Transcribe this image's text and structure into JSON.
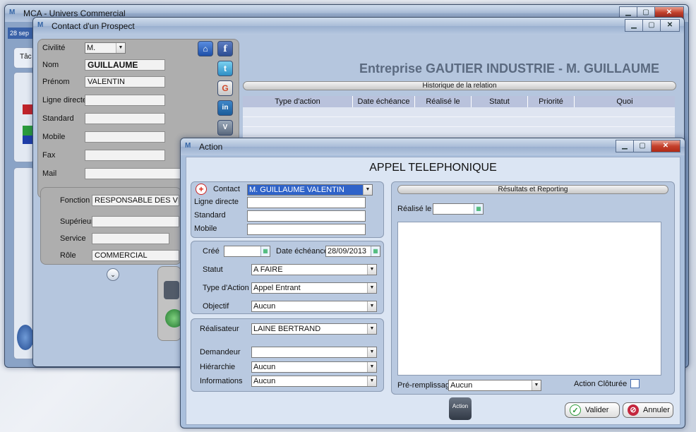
{
  "main_window": {
    "title": "MCA - Univers Commercial",
    "date_partial": "28 sep",
    "tab_partial": "Tâc"
  },
  "contact_window": {
    "title": "Contact d'un Prospect",
    "fields": {
      "civilite": {
        "label": "Civilité",
        "value": "M."
      },
      "nom": {
        "label": "Nom",
        "value": "GUILLAUME"
      },
      "prenom": {
        "label": "Prénom",
        "value": "VALENTIN"
      },
      "ligne_directe": {
        "label": "Ligne directe",
        "value": ""
      },
      "standard": {
        "label": "Standard",
        "value": ""
      },
      "mobile": {
        "label": "Mobile",
        "value": ""
      },
      "fax": {
        "label": "Fax",
        "value": ""
      },
      "mail": {
        "label": "Mail",
        "value": ""
      },
      "fonction": {
        "label": "Fonction",
        "value": "RESPONSABLE DES VENTES"
      },
      "superieur": {
        "label": "Supérieur",
        "value": ""
      },
      "service": {
        "label": "Service",
        "value": ""
      },
      "role": {
        "label": "Rôle",
        "value": "COMMERCIAL"
      }
    },
    "company_heading": "Entreprise GAUTIER INDUSTRIE - M. GUILLAUME",
    "history": {
      "title": "Historique de la relation",
      "columns": [
        "Type d'action",
        "Date échéance",
        "Réalisé le",
        "Statut",
        "Priorité",
        "Quoi"
      ]
    },
    "social": [
      "home-icon",
      "facebook-icon",
      "twitter-icon",
      "google-icon",
      "linkedin-icon",
      "viadeo-icon"
    ]
  },
  "action_window": {
    "title": "Action",
    "heading": "APPEL TELEPHONIQUE",
    "contact": {
      "label": "Contact",
      "value": "M. GUILLAUME VALENTIN",
      "ligne_directe_label": "Ligne directe",
      "standard_label": "Standard",
      "mobile_label": "Mobile"
    },
    "dates": {
      "cree_label": "Créé",
      "cree_value": "",
      "echeance_label": "Date échéance",
      "echeance_value": "28/09/2013"
    },
    "statut": {
      "label": "Statut",
      "value": "A FAIRE"
    },
    "type_action": {
      "label": "Type d'Action",
      "value": "Appel Entrant"
    },
    "objectif": {
      "label": "Objectif",
      "value": "Aucun"
    },
    "realisateur": {
      "label": "Réalisateur",
      "value": "LAINE BERTRAND"
    },
    "demandeur": {
      "label": "Demandeur",
      "value": ""
    },
    "hierarchie": {
      "label": "Hiérarchie",
      "value": "Aucun"
    },
    "informations": {
      "label": "Informations",
      "value": "Aucun"
    },
    "results": {
      "title": "Résultats et Reporting",
      "realise_label": "Réalisé le",
      "preremplissage_label": "Pré-remplissage",
      "preremplissage_value": "Aucun",
      "cloturee_label": "Action Clôturée"
    },
    "bottom_icon_label": "Action",
    "valider_label": "Valider",
    "annuler_label": "Annuler"
  }
}
